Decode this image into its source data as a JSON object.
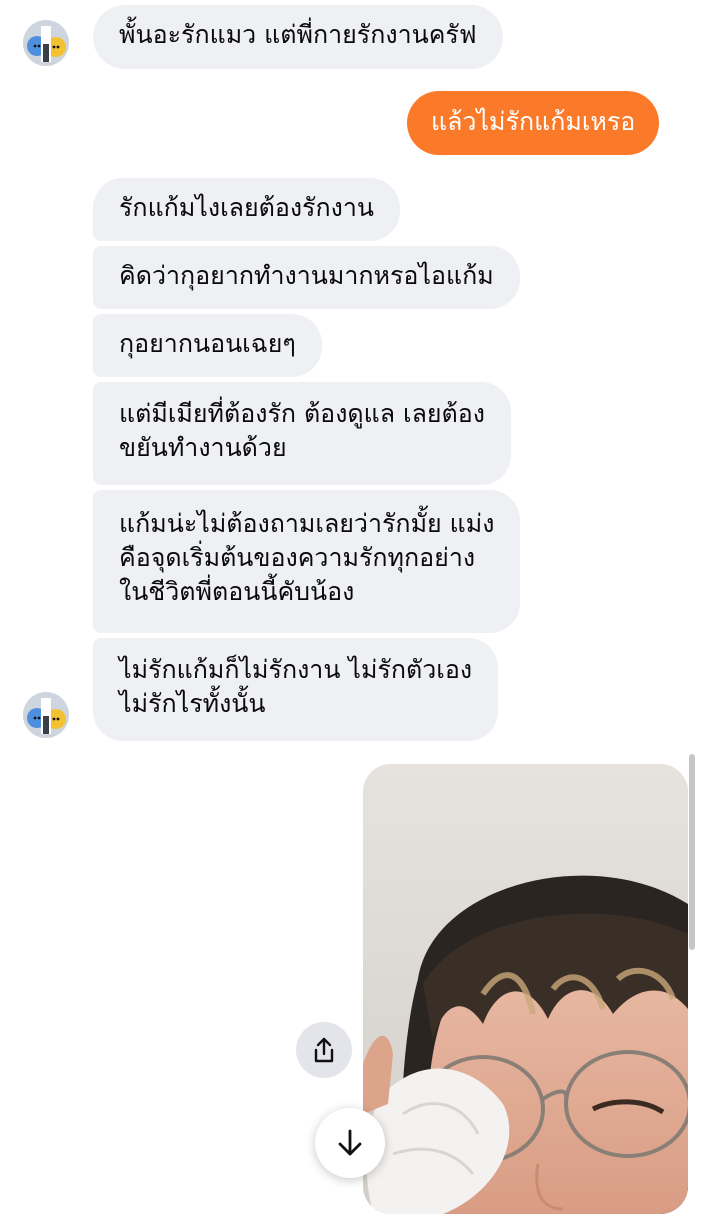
{
  "chat": {
    "messages": [
      {
        "side": "in",
        "text": "พั้นอะรักแมว แต่พี่กายรักงานครัฟ"
      },
      {
        "side": "out",
        "text": "แล้วไม่รักแก้มเหรอ"
      },
      {
        "side": "in",
        "text": "รักแก้มไงเลยต้องรักงาน"
      },
      {
        "side": "in",
        "text": "คิดว่ากุอยากทำงานมากหรอไอแก้ม"
      },
      {
        "side": "in",
        "text": "กุอยากนอนเฉยๆ"
      },
      {
        "side": "in",
        "lines": [
          "แต่มีเมียที่ต้องรัก ต้องดูแล เลยต้อง",
          "ขยันทำงานด้วย"
        ]
      },
      {
        "side": "in",
        "lines": [
          "แก้มน่ะไม่ต้องถามเลยว่ารักมั้ย แม่ง",
          "คือจุดเริ่มต้นของความรักทุกอย่าง",
          "ในชีวิตพี่ตอนนี้คับน้อง"
        ]
      },
      {
        "side": "in",
        "lines": [
          "ไม่รักแก้มก็ไม่รักงาน ไม่รักตัวเอง",
          "ไม่รักไรทั้งนั้น"
        ]
      }
    ]
  },
  "colors": {
    "outgoing_bubble": "#fb7a29",
    "incoming_bubble": "#eff0f4",
    "background": "#ffffff"
  },
  "icons": {
    "share": "share-icon",
    "scroll_down": "arrow-down-icon",
    "avatar": "avatar"
  }
}
